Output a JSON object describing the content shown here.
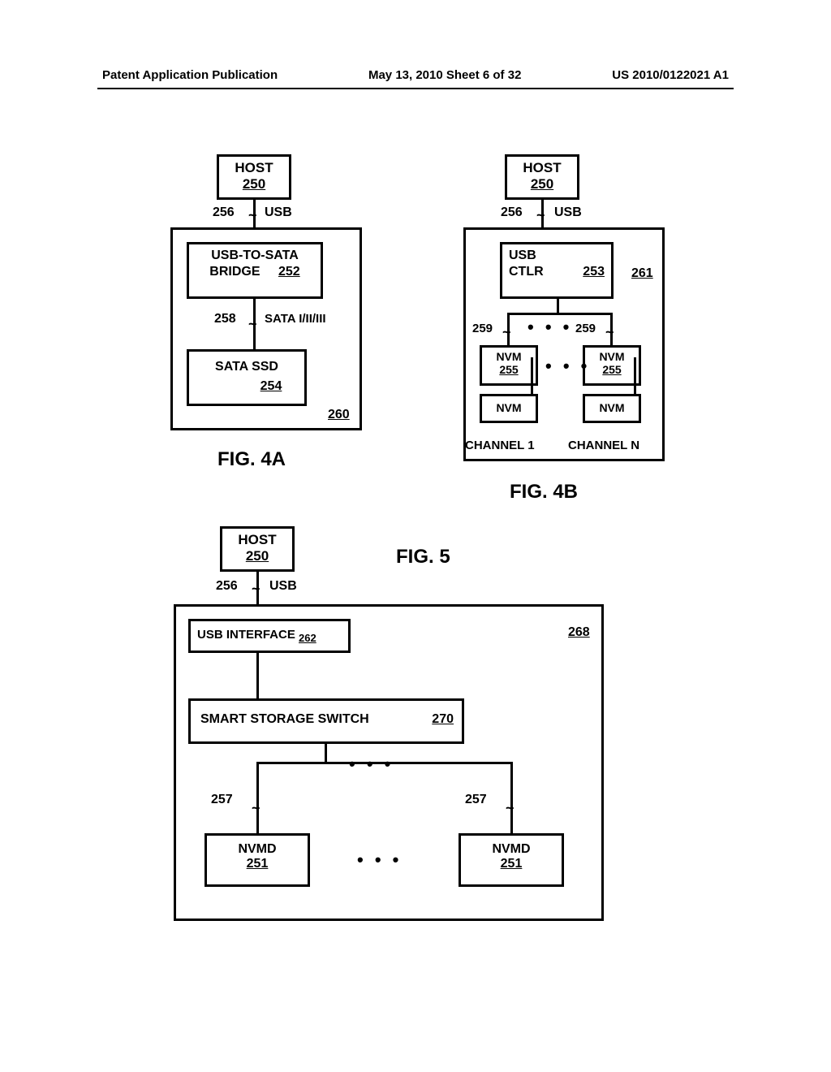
{
  "header": {
    "left": "Patent Application Publication",
    "center": "May 13, 2010  Sheet 6 of 32",
    "right": "US 2010/0122021 A1"
  },
  "fig4a": {
    "caption": "FIG. 4A",
    "host": {
      "label": "HOST",
      "ref": "250"
    },
    "usb": {
      "ref": "256",
      "label": "USB"
    },
    "bridge": {
      "label1": "USB-TO-SATA",
      "label2": "BRIDGE",
      "ref": "252"
    },
    "sata": {
      "ref": "258",
      "label": "SATA I/II/III"
    },
    "ssd": {
      "label": "SATA  SSD",
      "ref": "254"
    },
    "outer_ref": "260"
  },
  "fig4b": {
    "caption": "FIG. 4B",
    "host": {
      "label": "HOST",
      "ref": "250"
    },
    "usb": {
      "ref": "256",
      "label": "USB"
    },
    "ctlr": {
      "label1": "USB",
      "label2": "CTLR",
      "ref": "253"
    },
    "outer_ref": "261",
    "chan_ref1": "259",
    "chan_ref2": "259",
    "nvm": {
      "label": "NVM",
      "ref": "255"
    },
    "nvm2": {
      "label": "NVM"
    },
    "ch1": "CHANNEL 1",
    "chn": "CHANNEL N",
    "dots": "• • •"
  },
  "fig5": {
    "caption": "FIG. 5",
    "host": {
      "label": "HOST",
      "ref": "250"
    },
    "usb": {
      "ref": "256",
      "label": "USB"
    },
    "usbif": {
      "label": "USB INTERFACE",
      "ref": "262"
    },
    "outer_ref": "268",
    "switch": {
      "label": "SMART STORAGE SWITCH",
      "ref": "270"
    },
    "conn_ref1": "257",
    "conn_ref2": "257",
    "nvmd": {
      "label": "NVMD",
      "ref": "251"
    },
    "dots": "• • •"
  }
}
